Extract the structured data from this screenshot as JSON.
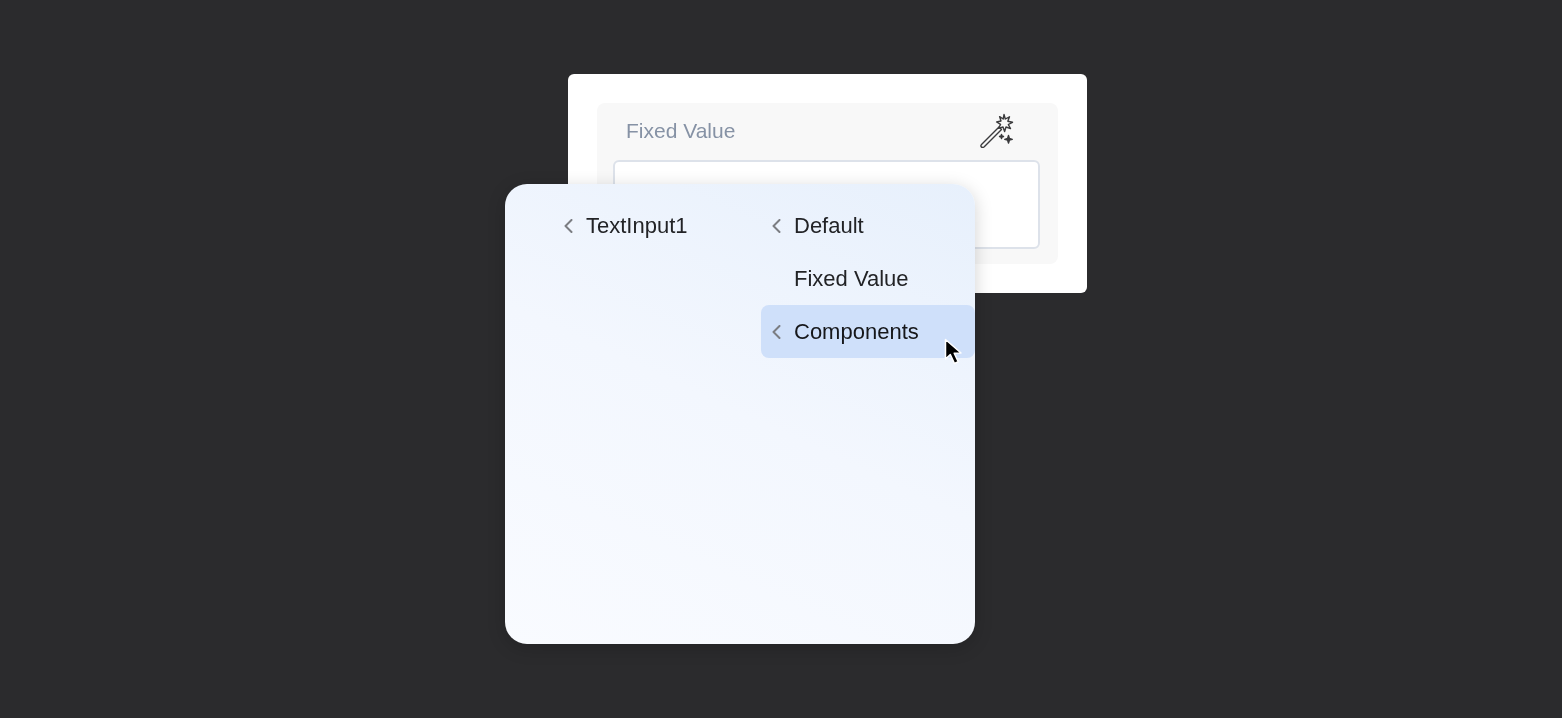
{
  "property_card": {
    "field_label": "Fixed Value"
  },
  "menu": {
    "columns": [
      {
        "items": [
          {
            "label": "TextInput1",
            "has_submenu": true,
            "selected": false
          }
        ]
      },
      {
        "items": [
          {
            "label": "Default",
            "has_submenu": true,
            "selected": false
          },
          {
            "label": "Fixed Value",
            "has_submenu": false,
            "selected": false
          },
          {
            "label": "Components",
            "has_submenu": true,
            "selected": true
          }
        ]
      }
    ]
  }
}
